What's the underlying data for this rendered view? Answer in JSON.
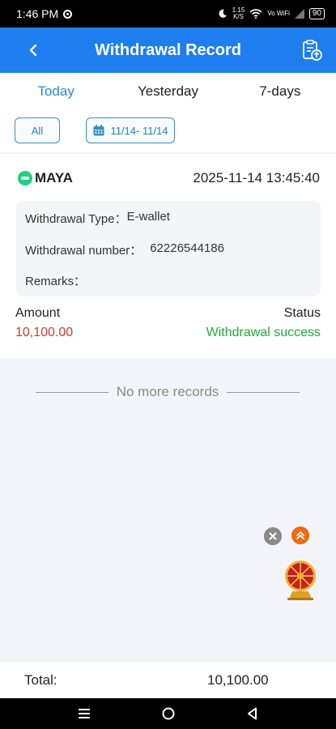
{
  "status_bar": {
    "time": "1:46 PM",
    "net_speed_value": "1.15",
    "net_speed_unit": "K/S",
    "network_label": "Vo WiFi",
    "battery": "90"
  },
  "header": {
    "title": "Withdrawal Record",
    "back_icon": "chevron-left-icon",
    "action_icon": "clipboard-upload-icon"
  },
  "tabs": [
    {
      "label": "Today",
      "active": true
    },
    {
      "label": "Yesterday",
      "active": false
    },
    {
      "label": "7-days",
      "active": false
    }
  ],
  "filters": {
    "all_label": "All",
    "date_range": "11/14- 11/14"
  },
  "record": {
    "brand": "MAYA",
    "datetime": "2025-11-14 13:45:40",
    "type_label": "Withdrawal Type：",
    "type_value": "E-wallet",
    "number_label": "Withdrawal number：",
    "number_value": "62226544186",
    "remarks_label": "Remarks：",
    "remarks_value": "",
    "amount_label": "Amount",
    "amount_value": "10,100.00",
    "status_label": "Status",
    "status_value": "Withdrawal success"
  },
  "no_more_text": "No more records",
  "total": {
    "label": "Total:",
    "value": "10,100.00"
  },
  "colors": {
    "header_bg": "#1e7ef0",
    "active_tab": "#2a8cc9",
    "amount_red": "#d23a2a",
    "success_green": "#23a938"
  }
}
